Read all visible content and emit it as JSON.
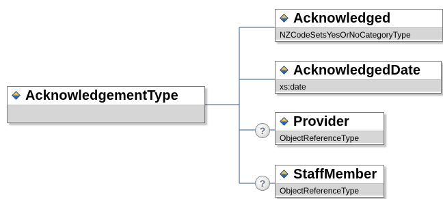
{
  "root": {
    "title": "AcknowledgementType"
  },
  "children": [
    {
      "title": "Acknowledged",
      "type": "NZCodeSetsYesOrNoCategoryType",
      "optional": false
    },
    {
      "title": "AcknowledgedDate",
      "type": "xs:date",
      "optional": false
    },
    {
      "title": "Provider",
      "type": "ObjectReferenceType",
      "optional": true,
      "optional_mark": "?"
    },
    {
      "title": "StaffMember",
      "type": "ObjectReferenceType",
      "optional": true,
      "optional_mark": "?"
    }
  ],
  "colors": {
    "connector": "#2f5a8a",
    "border": "#7b7b7b",
    "type_bg": "#d6d6d6",
    "icon_gold": "#e9b73b",
    "icon_blue": "#1b4f9e"
  },
  "icons": {
    "element": "element-diamond-icon",
    "optional": "optional-question-icon"
  }
}
